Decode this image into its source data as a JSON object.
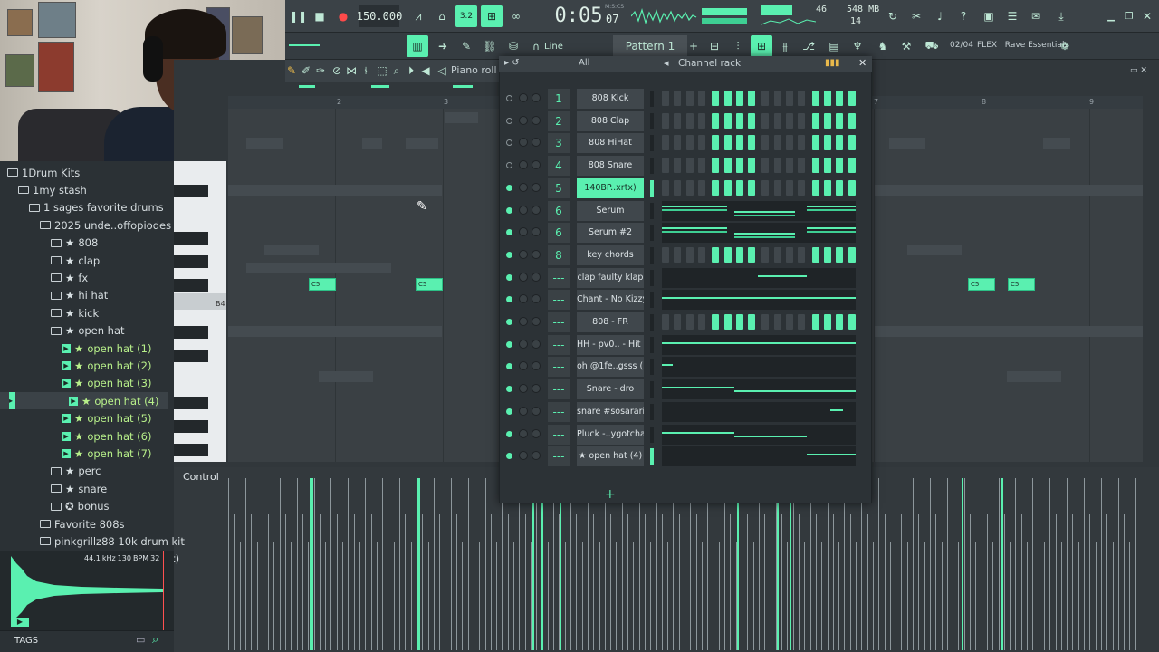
{
  "transport": {
    "tempo": "150.000",
    "time": "0:05",
    "time_fraction": "07",
    "time_unit": "M:S:CS",
    "cpu_value": "46",
    "memory": "548 MB",
    "voices": "14",
    "pattern": "Pattern 1",
    "snap": "Line",
    "preset_counter": "02/04",
    "preset_name": "FLEX | Rave Essentials",
    "pattern_step_badge": "3.2"
  },
  "piano_roll": {
    "title": "Piano roll",
    "ruler_marks": [
      "2",
      "3",
      "7",
      "8",
      "9"
    ],
    "note_label": "C5",
    "key_label": "B4",
    "control_label": "Control"
  },
  "channel_rack": {
    "title": "Channel rack",
    "filter": "All",
    "add_button": "+",
    "channels": [
      {
        "num": "1",
        "name": "808 Kick",
        "type": "steps",
        "on": false,
        "highlight": false,
        "steps": [
          0,
          0,
          0,
          0,
          1,
          1,
          1,
          1,
          0,
          0,
          0,
          0,
          1,
          1,
          1,
          1
        ]
      },
      {
        "num": "2",
        "name": "808 Clap",
        "type": "steps",
        "on": false,
        "highlight": false,
        "steps": [
          0,
          0,
          0,
          0,
          1,
          1,
          1,
          1,
          0,
          0,
          0,
          0,
          1,
          1,
          1,
          1
        ]
      },
      {
        "num": "3",
        "name": "808 HiHat",
        "type": "steps",
        "on": false,
        "highlight": false,
        "steps": [
          0,
          0,
          0,
          0,
          1,
          1,
          1,
          1,
          0,
          0,
          0,
          0,
          1,
          1,
          1,
          1
        ]
      },
      {
        "num": "4",
        "name": "808 Snare",
        "type": "steps",
        "on": false,
        "highlight": false,
        "steps": [
          0,
          0,
          0,
          0,
          1,
          1,
          1,
          1,
          0,
          0,
          0,
          0,
          1,
          1,
          1,
          1
        ]
      },
      {
        "num": "5",
        "name": "140BP..xrtx)",
        "type": "steps",
        "on": true,
        "highlight": true,
        "steps": [
          0,
          0,
          0,
          0,
          1,
          1,
          1,
          1,
          0,
          0,
          0,
          0,
          1,
          1,
          1,
          1
        ]
      },
      {
        "num": "6",
        "name": "Serum",
        "type": "roll",
        "on": true,
        "highlight": false
      },
      {
        "num": "6",
        "name": "Serum #2",
        "type": "roll",
        "on": true,
        "highlight": false
      },
      {
        "num": "8",
        "name": "key chords",
        "type": "steps",
        "on": true,
        "highlight": false,
        "steps": [
          0,
          0,
          0,
          0,
          1,
          1,
          1,
          1,
          0,
          0,
          0,
          0,
          1,
          1,
          1,
          1
        ]
      },
      {
        "num": "---",
        "name": "clap faulty klap",
        "type": "roll",
        "on": true,
        "highlight": false
      },
      {
        "num": "---",
        "name": "Chant - No Kizzy",
        "type": "roll",
        "on": true,
        "highlight": false
      },
      {
        "num": "---",
        "name": "808 - FR",
        "type": "steps",
        "on": true,
        "highlight": false,
        "steps": [
          0,
          0,
          0,
          0,
          1,
          1,
          1,
          1,
          0,
          0,
          0,
          0,
          1,
          1,
          1,
          1
        ]
      },
      {
        "num": "---",
        "name": "HH - pv0.. - Hit 1",
        "type": "roll",
        "on": true,
        "highlight": false
      },
      {
        "num": "---",
        "name": "oh @1fe..gsss (3)",
        "type": "roll",
        "on": true,
        "highlight": false
      },
      {
        "num": "---",
        "name": "Snare - dro",
        "type": "roll",
        "on": true,
        "highlight": false
      },
      {
        "num": "---",
        "name": "snare #sosarari",
        "type": "roll",
        "on": true,
        "highlight": false
      },
      {
        "num": "---",
        "name": "Pluck -..ygotcha]",
        "type": "roll",
        "on": true,
        "highlight": false
      },
      {
        "num": "---",
        "name": "★ open hat (4)",
        "type": "roll",
        "on": true,
        "highlight": false
      }
    ]
  },
  "browser": {
    "items": [
      {
        "label": "1Drum Kits",
        "kind": "folder",
        "level": 0
      },
      {
        "label": "1my stash",
        "kind": "folder",
        "level": 1
      },
      {
        "label": "1 sages favorite drums",
        "kind": "folder",
        "level": 2
      },
      {
        "label": "2025 unde..offopiodes",
        "kind": "folder",
        "level": 3
      },
      {
        "label": "808",
        "kind": "starfolder",
        "level": 4
      },
      {
        "label": "clap",
        "kind": "starfolder",
        "level": 4
      },
      {
        "label": "fx",
        "kind": "starfolder",
        "level": 4
      },
      {
        "label": "hi hat",
        "kind": "starfolder",
        "level": 4
      },
      {
        "label": "kick",
        "kind": "starfolder",
        "level": 4
      },
      {
        "label": "open hat",
        "kind": "starfolder",
        "level": 4
      },
      {
        "label": "open hat (1)",
        "kind": "sample",
        "level": 5
      },
      {
        "label": "open hat (2)",
        "kind": "sample",
        "level": 5
      },
      {
        "label": "open hat (3)",
        "kind": "sample",
        "level": 5
      },
      {
        "label": "open hat (4)",
        "kind": "sample",
        "level": 5,
        "selected": true
      },
      {
        "label": "open hat (5)",
        "kind": "sample",
        "level": 5
      },
      {
        "label": "open hat (6)",
        "kind": "sample",
        "level": 5
      },
      {
        "label": "open hat (7)",
        "kind": "sample",
        "level": 5
      },
      {
        "label": "perc",
        "kind": "starfolder",
        "level": 4
      },
      {
        "label": "snare",
        "kind": "starfolder",
        "level": 4
      },
      {
        "label": "bonus",
        "kind": "cfolder",
        "level": 4
      },
      {
        "label": "Favorite 808s",
        "kind": "folder",
        "level": 3
      },
      {
        "label": "pinkgrillz88 10k drum kit",
        "kind": "folder",
        "level": 3
      },
      {
        "label": "Polo Boy S..T (Drum Kit)",
        "kind": "folder",
        "level": 3
      }
    ],
    "sample_info": {
      "rate": "44.1",
      "rate_unit": "kHz",
      "bpm": "130",
      "bpm_unit": "BPM",
      "bits": "32"
    },
    "tags_label": "TAGS"
  },
  "colors": {
    "accent": "#5af0b0",
    "panel": "#2c3236",
    "toolbar": "#3b4247"
  }
}
